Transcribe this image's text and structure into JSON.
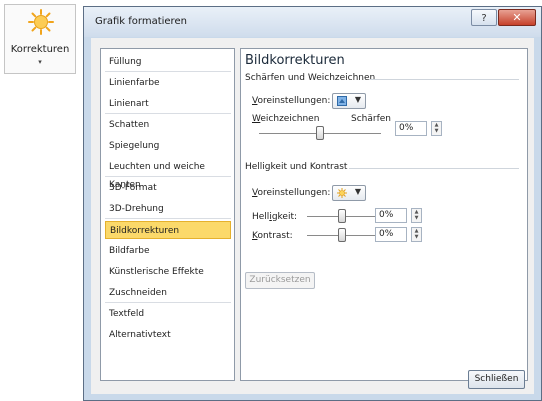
{
  "ribbon": {
    "label": "Korrekturen",
    "dropdown_arrow": "▾",
    "icon": "sun-icon",
    "icon_color": "#f5b72a"
  },
  "dialog": {
    "title": "Grafik formatieren",
    "help_label": "?",
    "close_label": "✕",
    "close_button_label": "Schließen"
  },
  "nav": {
    "items": [
      {
        "label": "Füllung"
      },
      {
        "label": "Linienfarbe"
      },
      {
        "label": "Linienart"
      },
      {
        "label": "Schatten"
      },
      {
        "label": "Spiegelung"
      },
      {
        "label": "Leuchten und weiche Kanten"
      },
      {
        "label": "3D-Format"
      },
      {
        "label": "3D-Drehung"
      },
      {
        "label": "Bildkorrekturen",
        "selected": true
      },
      {
        "label": "Bildfarbe"
      },
      {
        "label": "Künstlerische Effekte"
      },
      {
        "label": "Zuschneiden"
      },
      {
        "label": "Textfeld"
      },
      {
        "label": "Alternativtext"
      }
    ]
  },
  "panel": {
    "title": "Bildkorrekturen",
    "sharpen": {
      "section_label": "Schärfen und Weichzeichnen",
      "presets_label": "Voreinstellungen:",
      "soften_label": "Weichzeichnen",
      "sharpen_label": "Schärfen",
      "value": "0%",
      "slider_level": 0.5
    },
    "brightness_contrast": {
      "section_label": "Helligkeit und Kontrast",
      "presets_label": "Voreinstellungen:",
      "brightness_label": "Helligkeit:",
      "brightness_value": "0%",
      "brightness_level": 0.5,
      "contrast_label": "Kontrast:",
      "contrast_value": "0%",
      "contrast_level": 0.5
    },
    "reset_label": "Zurücksetzen"
  },
  "colors": {
    "selection": "#fbd96a",
    "close_red": "#c6412a",
    "frame_blue": "#c9d9ea"
  }
}
